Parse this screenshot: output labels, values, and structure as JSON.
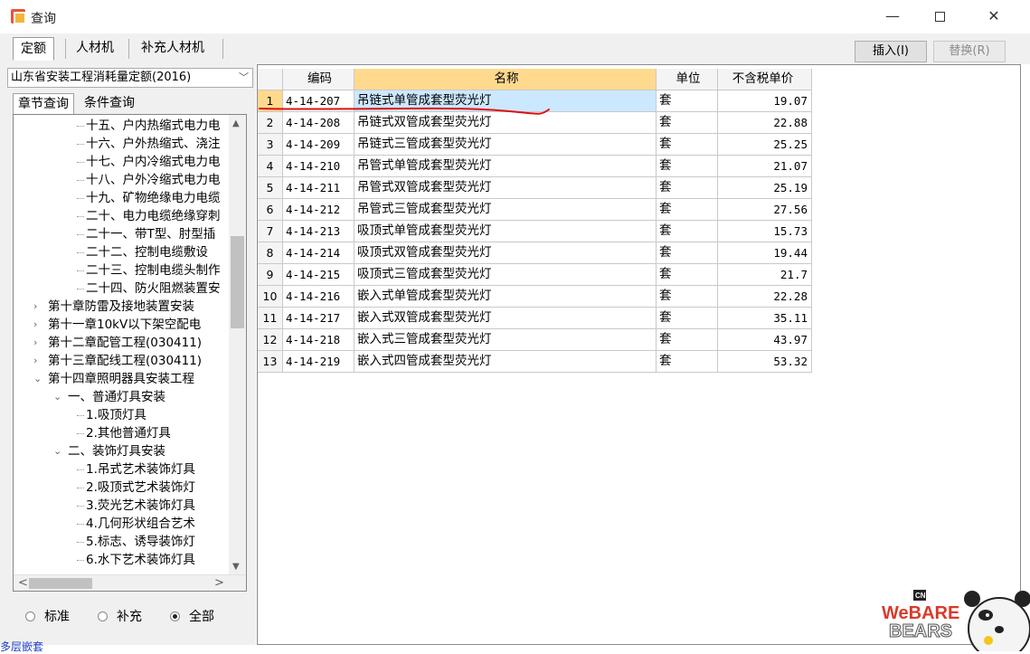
{
  "window": {
    "title": "查询",
    "minimize_glyph": "—",
    "close_glyph": "✕"
  },
  "tabs": [
    {
      "label": "定额",
      "active": true
    },
    {
      "label": "人材机",
      "active": false
    },
    {
      "label": "补充人材机",
      "active": false
    }
  ],
  "toolbar": {
    "insert_label": "插入(I)",
    "replace_label": "替换(R)"
  },
  "left": {
    "quota_library": "山东省安装工程消耗量定额(2016)",
    "subtabs": [
      "章节查询",
      "条件查询"
    ],
    "tree": [
      {
        "label": "十五、户内热缩式电力电",
        "level": 3
      },
      {
        "label": "十六、户外热缩式、浇注",
        "level": 3
      },
      {
        "label": "十七、户内冷缩式电力电",
        "level": 3
      },
      {
        "label": "十八、户外冷缩式电力电",
        "level": 3
      },
      {
        "label": "十九、矿物绝缘电力电缆",
        "level": 3
      },
      {
        "label": "二十、电力电缆绝缘穿刺",
        "level": 3
      },
      {
        "label": "二十一、带T型、肘型插",
        "level": 3
      },
      {
        "label": "二十二、控制电缆敷设",
        "level": 3
      },
      {
        "label": "二十三、控制电缆头制作",
        "level": 3
      },
      {
        "label": "二十四、防火阻燃装置安",
        "level": 3
      },
      {
        "label": "第十章防雷及接地装置安装",
        "level": 1,
        "expander": "›"
      },
      {
        "label": "第十一章10kV以下架空配电",
        "level": 1,
        "expander": "›"
      },
      {
        "label": "第十二章配管工程(030411)",
        "level": 1,
        "expander": "›"
      },
      {
        "label": "第十三章配线工程(030411)",
        "level": 1,
        "expander": "›"
      },
      {
        "label": "第十四章照明器具安装工程",
        "level": 1,
        "expander": "⌄"
      },
      {
        "label": "一、普通灯具安装",
        "level": 2,
        "expander": "⌄"
      },
      {
        "label": "1.吸顶灯具",
        "level": 3
      },
      {
        "label": "2.其他普通灯具",
        "level": 3
      },
      {
        "label": "二、装饰灯具安装",
        "level": 2,
        "expander": "⌄"
      },
      {
        "label": "1.吊式艺术装饰灯具",
        "level": 3
      },
      {
        "label": "2.吸顶式艺术装饰灯",
        "level": 3
      },
      {
        "label": "3.荧光艺术装饰灯具",
        "level": 3
      },
      {
        "label": "4.几何形状组合艺术",
        "level": 3
      },
      {
        "label": "5.标志、诱导装饰灯",
        "level": 3
      },
      {
        "label": "6.水下艺术装饰灯具",
        "level": 3
      }
    ],
    "scroll": {
      "up": "▲",
      "down": "▼",
      "left": "<",
      "right": ">"
    },
    "filters": [
      {
        "label": "标准",
        "checked": false
      },
      {
        "label": "补充",
        "checked": false
      },
      {
        "label": "全部",
        "checked": true
      }
    ]
  },
  "table": {
    "columns": [
      "编码",
      "名称",
      "单位",
      "不含税单价"
    ],
    "rows": [
      {
        "idx": "1",
        "code": "4-14-207",
        "name": "吊链式单管成套型荧光灯",
        "unit": "套",
        "price": "19.07"
      },
      {
        "idx": "2",
        "code": "4-14-208",
        "name": "吊链式双管成套型荧光灯",
        "unit": "套",
        "price": "22.88"
      },
      {
        "idx": "3",
        "code": "4-14-209",
        "name": "吊链式三管成套型荧光灯",
        "unit": "套",
        "price": "25.25"
      },
      {
        "idx": "4",
        "code": "4-14-210",
        "name": "吊管式单管成套型荧光灯",
        "unit": "套",
        "price": "21.07"
      },
      {
        "idx": "5",
        "code": "4-14-211",
        "name": "吊管式双管成套型荧光灯",
        "unit": "套",
        "price": "25.19"
      },
      {
        "idx": "6",
        "code": "4-14-212",
        "name": "吊管式三管成套型荧光灯",
        "unit": "套",
        "price": "27.56"
      },
      {
        "idx": "7",
        "code": "4-14-213",
        "name": "吸顶式单管成套型荧光灯",
        "unit": "套",
        "price": "15.73"
      },
      {
        "idx": "8",
        "code": "4-14-214",
        "name": "吸顶式双管成套型荧光灯",
        "unit": "套",
        "price": "19.44"
      },
      {
        "idx": "9",
        "code": "4-14-215",
        "name": "吸顶式三管成套型荧光灯",
        "unit": "套",
        "price": "21.7"
      },
      {
        "idx": "10",
        "code": "4-14-216",
        "name": "嵌入式单管成套型荧光灯",
        "unit": "套",
        "price": "22.28"
      },
      {
        "idx": "11",
        "code": "4-14-217",
        "name": "嵌入式双管成套型荧光灯",
        "unit": "套",
        "price": "35.11"
      },
      {
        "idx": "12",
        "code": "4-14-218",
        "name": "嵌入式三管成套型荧光灯",
        "unit": "套",
        "price": "43.97"
      },
      {
        "idx": "13",
        "code": "4-14-219",
        "name": "嵌入式四管成套型荧光灯",
        "unit": "套",
        "price": "53.32"
      }
    ],
    "selected_row": 0
  },
  "status_text": "多层嵌套",
  "mascot": {
    "brand": "CN",
    "text_top": "WeBARE",
    "text_bottom": "BEARS"
  },
  "colors": {
    "selected_row": "#cce8ff",
    "header_highlight": "#ffd98e",
    "annotation": "#e01010"
  }
}
